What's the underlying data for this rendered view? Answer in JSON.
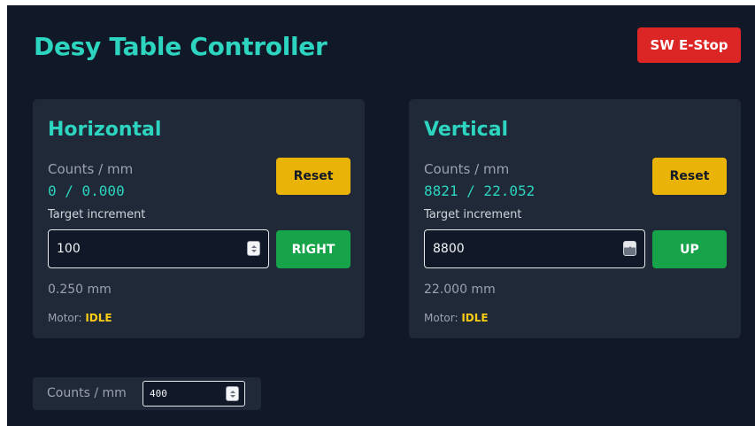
{
  "header": {
    "title": "Desy Table Controller",
    "estop_label": "SW E-Stop"
  },
  "axes": [
    {
      "title": "Horizontal",
      "counts_label": "Counts / mm",
      "counts_value": "0 / 0.000",
      "reset_label": "Reset",
      "target_label": "Target increment",
      "increment_value": "100",
      "move_label": "RIGHT",
      "mm_value": "0.250 mm",
      "motor_label": "Motor:",
      "motor_state": "IDLE"
    },
    {
      "title": "Vertical",
      "counts_label": "Counts / mm",
      "counts_value": "8821 / 22.052",
      "reset_label": "Reset",
      "target_label": "Target increment",
      "increment_value": "8800",
      "move_label": "UP",
      "mm_value": "22.000 mm",
      "motor_label": "Motor:",
      "motor_state": "IDLE"
    }
  ],
  "settings": {
    "counts_per_mm_label": "Counts / mm",
    "counts_per_mm_value": "400"
  },
  "colors": {
    "accent": "#2dd4bf",
    "estop": "#dc2626",
    "reset": "#eab308",
    "move": "#16a34a",
    "motor_state": "#facc15",
    "background": "#111827",
    "panel": "#1f2937"
  },
  "icons": {
    "spinner": "number-spinner-icon"
  }
}
